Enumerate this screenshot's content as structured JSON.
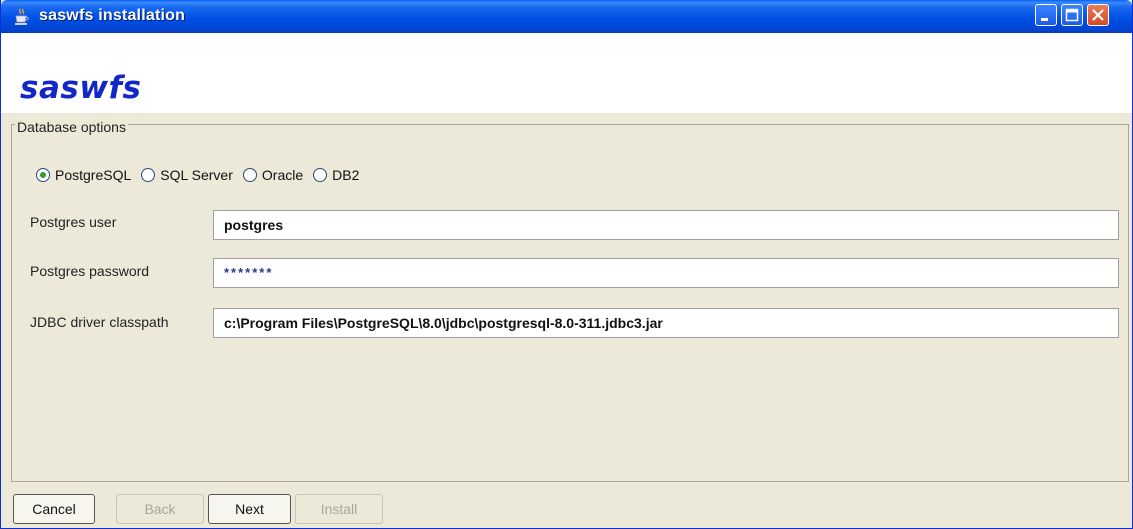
{
  "window": {
    "title": "saswfs installation",
    "icons": {
      "app": "java-cup-icon",
      "minimize": "minimize-icon",
      "maximize": "maximize-icon",
      "close": "close-icon"
    }
  },
  "banner": {
    "logo": "saswfs"
  },
  "database": {
    "legend": "Database options",
    "options": [
      {
        "label": "PostgreSQL",
        "selected": true
      },
      {
        "label": "SQL Server",
        "selected": false
      },
      {
        "label": "Oracle",
        "selected": false
      },
      {
        "label": "DB2",
        "selected": false
      }
    ],
    "user_label": "Postgres user",
    "user_value": "postgres",
    "password_label": "Postgres password",
    "password_value": "*******",
    "classpath_label": "JDBC driver classpath",
    "classpath_value": "c:\\Program Files\\PostgreSQL\\8.0\\jdbc\\postgresql-8.0-311.jdbc3.jar"
  },
  "buttons": {
    "cancel": "Cancel",
    "back": "Back",
    "next": "Next",
    "install": "Install"
  },
  "colors": {
    "titlebar": "#0050E6",
    "logo": "#1028C8",
    "background": "#ECE9D8",
    "radio_selected": "#2FA02F"
  }
}
